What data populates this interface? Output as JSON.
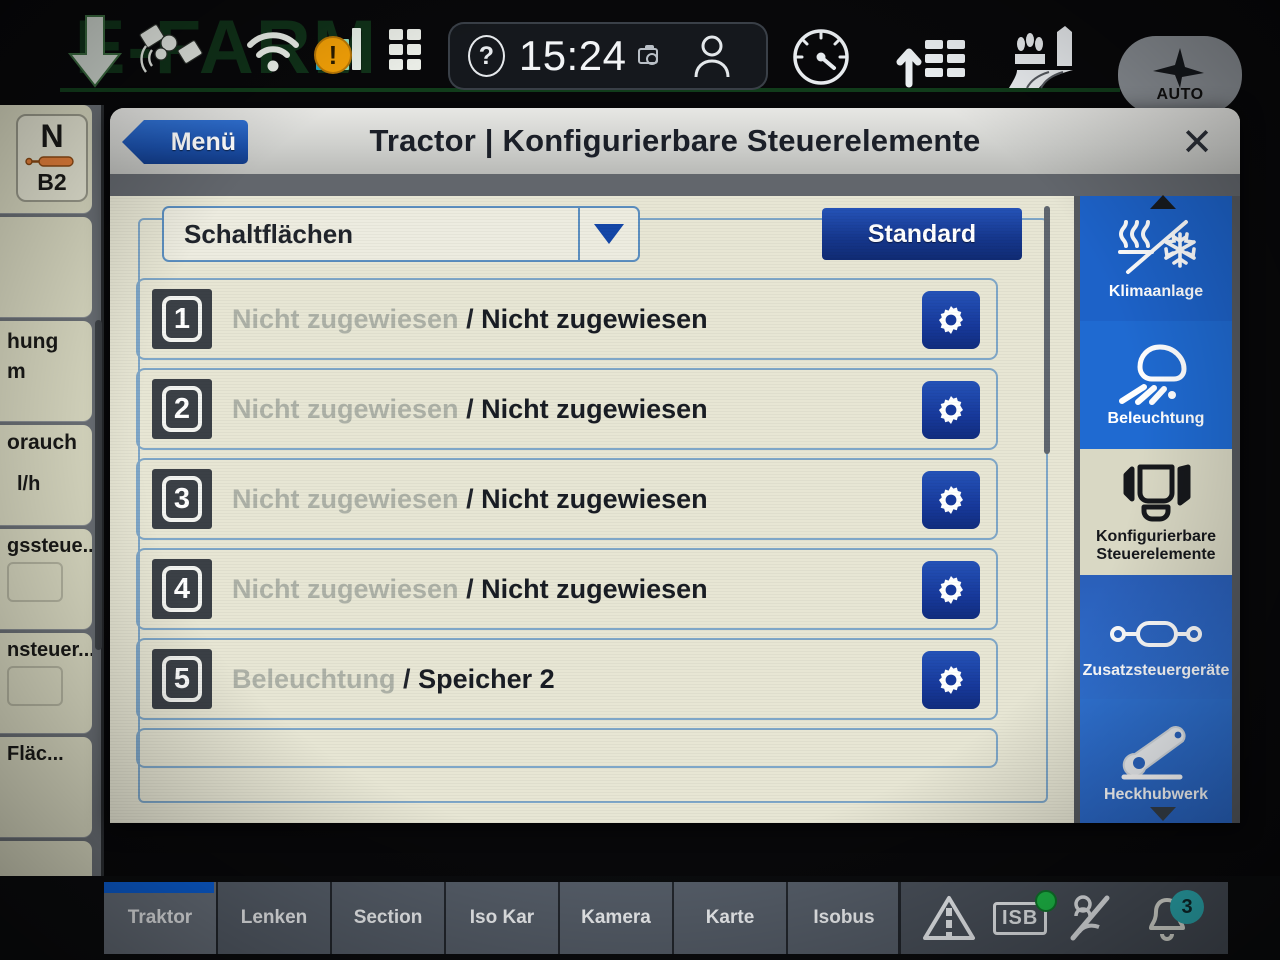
{
  "watermark": {
    "text": "E-FARM"
  },
  "topbar": {
    "clock": "15:24",
    "help_label": "?",
    "icons": [
      {
        "name": "satellite-icon",
        "label": "satellite"
      },
      {
        "name": "warning-icon",
        "label": "!"
      },
      {
        "name": "wifi-icon",
        "label": "wifi"
      },
      {
        "name": "signal-bars-icon",
        "label": "signal"
      },
      {
        "name": "apps-grid-icon",
        "label": "apps"
      },
      {
        "name": "camera-icon",
        "label": "camera"
      },
      {
        "name": "user-icon",
        "label": "operator"
      },
      {
        "name": "gauge-icon",
        "label": "performance"
      },
      {
        "name": "implement-up-icon",
        "label": "implement"
      },
      {
        "name": "field-icon",
        "label": "field"
      }
    ],
    "auto_button": "AUTO"
  },
  "left_panel": {
    "gear_tile": {
      "gear": "N",
      "range": "B2"
    },
    "tiles": [
      {
        "label": ""
      },
      {
        "label": "hung\nm"
      },
      {
        "label": "orauch",
        "unit": "l/h"
      },
      {
        "label": "gssteue..."
      },
      {
        "label": "nsteuer..."
      },
      {
        "label": "Fläc..."
      },
      {
        "label": ""
      }
    ]
  },
  "dialog": {
    "menu_button": "Menü",
    "title": "Tractor | Konfigurierbare Steuerelemente",
    "close_label": "✕",
    "dropdown": {
      "value": "Schaltflächen"
    },
    "standard_button": "Standard",
    "rows": [
      {
        "num": "1",
        "assigned": "Nicht zugewiesen",
        "sep": "/",
        "target": "Nicht zugewiesen",
        "cog": "gear-icon"
      },
      {
        "num": "2",
        "assigned": "Nicht zugewiesen",
        "sep": "/",
        "target": "Nicht zugewiesen",
        "cog": "gear-icon"
      },
      {
        "num": "3",
        "assigned": "Nicht zugewiesen",
        "sep": "/",
        "target": "Nicht zugewiesen",
        "cog": "gear-icon"
      },
      {
        "num": "4",
        "assigned": "Nicht zugewiesen",
        "sep": "/",
        "target": "Nicht zugewiesen",
        "cog": "gear-icon"
      },
      {
        "num": "5",
        "assigned": "Beleuchtung",
        "sep": "/",
        "target": "Speicher 2",
        "cog": "gear-icon"
      }
    ]
  },
  "sidemenu": {
    "items": [
      {
        "label": "Klimaanlage",
        "icon": "climate-control-icon",
        "selected": false
      },
      {
        "label": "Beleuchtung",
        "icon": "work-light-icon",
        "selected": false
      },
      {
        "label": "Konfigurierbare Steuerelemente",
        "icon": "armrest-console-icon",
        "selected": true
      },
      {
        "label": "Zusatzsteuergeräte",
        "icon": "hydraulic-cylinder-icon",
        "selected": false
      },
      {
        "label": "Heckhubwerk",
        "icon": "rear-linkage-icon",
        "selected": false
      }
    ]
  },
  "tabbar": {
    "tabs": [
      {
        "label": "Traktor",
        "active": true
      },
      {
        "label": "Lenken",
        "active": false
      },
      {
        "label": "Section",
        "active": false
      },
      {
        "label": "Iso Kar",
        "active": false
      },
      {
        "label": "Kamera",
        "active": false
      },
      {
        "label": "Karte",
        "active": false
      },
      {
        "label": "Isobus",
        "active": false
      }
    ],
    "tray": [
      {
        "name": "lane-warning-icon",
        "label": ""
      },
      {
        "name": "isb-icon",
        "label": "ISB"
      },
      {
        "name": "no-signal-icon",
        "label": ""
      }
    ],
    "notifications": "3"
  },
  "colors": {
    "accent_blue": "#1b4fa8",
    "panel_beige": "#e7e6d4",
    "border_blue": "#7fa7c8",
    "badge_teal": "#2fb6bd",
    "tab_gray": "#565e69"
  }
}
